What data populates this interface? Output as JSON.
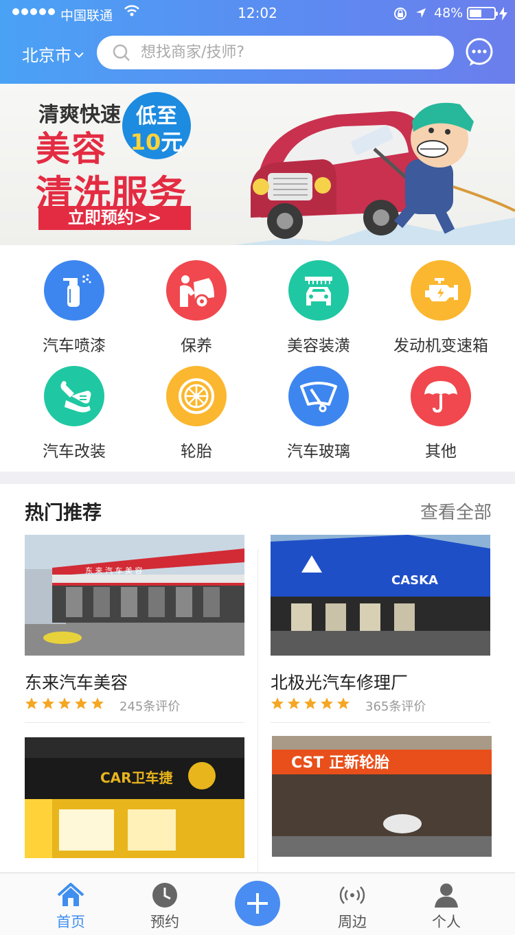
{
  "status_bar": {
    "carrier": "中国联通",
    "time": "12:02",
    "battery": "48%"
  },
  "header": {
    "city": "北京市",
    "search_placeholder": "想找商家/技师?"
  },
  "banner": {
    "line1": "清爽快速",
    "line2": "美容",
    "line3": "清洗服务",
    "bubble_top": "低至",
    "bubble_num": "10",
    "bubble_unit": "元",
    "cta": "立即预约>>"
  },
  "categories": [
    {
      "label": "汽车喷漆",
      "icon": "spray-bottle-icon",
      "color": "#3d86f0"
    },
    {
      "label": "保养",
      "icon": "car-repair-icon",
      "color": "#f0484e"
    },
    {
      "label": "美容装潢",
      "icon": "car-wash-icon",
      "color": "#1fc8a2"
    },
    {
      "label": "发动机变速箱",
      "icon": "engine-icon",
      "color": "#fbb72f"
    },
    {
      "label": "汽车改装",
      "icon": "wrench-hand-icon",
      "color": "#1fc8a2"
    },
    {
      "label": "轮胎",
      "icon": "tire-icon",
      "color": "#fbb72f"
    },
    {
      "label": "汽车玻璃",
      "icon": "wiper-icon",
      "color": "#3d86f0"
    },
    {
      "label": "其他",
      "icon": "umbrella-icon",
      "color": "#f0484e"
    }
  ],
  "hot": {
    "title": "热门推荐",
    "view_all": "查看全部",
    "shops": [
      {
        "name": "东来汽车美容",
        "reviews": "245条评价",
        "rating": 5,
        "sign": "东 来 汽 车 美 容"
      },
      {
        "name": "北极光汽车修理厂",
        "reviews": "365条评价",
        "rating": 5,
        "sign": "CASKA"
      },
      {
        "name": "",
        "sign": "CAR卫车捷"
      },
      {
        "name": "",
        "sign": "CST 正新轮胎"
      }
    ]
  },
  "tabbar": [
    {
      "label": "首页",
      "icon": "home-icon"
    },
    {
      "label": "预约",
      "icon": "clock-icon"
    },
    {
      "label": "周边",
      "icon": "radar-icon"
    },
    {
      "label": "个人",
      "icon": "person-icon"
    }
  ],
  "colors": {
    "header_start": "#4aa2f5",
    "header_end": "#6b7eec",
    "accent": "#3f8ef0",
    "star": "#f5a623",
    "banner_red": "#e32c42"
  }
}
